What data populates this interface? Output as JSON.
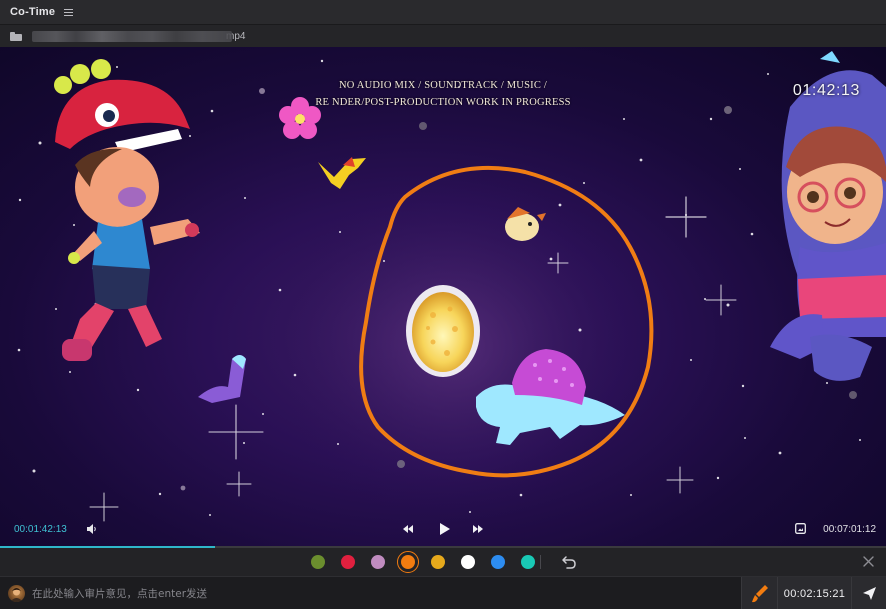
{
  "app": {
    "title": "Co-Time"
  },
  "file": {
    "name_visible_suffix": "mp4"
  },
  "video": {
    "watermark_line1": "NO AUDIO MIX / SOUNDTRACK / MUSIC /",
    "watermark_line2": "RE NDER/POST-PRODUCTION WORK IN PROGRESS",
    "timecode_overlay": "01:42:13"
  },
  "player": {
    "current_time": "00:01:42:13",
    "duration": "00:07:01:12",
    "progress_fraction": 0.243,
    "icons": [
      "volume-icon",
      "rewind-icon",
      "play-icon",
      "fast-forward-icon",
      "fullscreen-icon"
    ]
  },
  "annotation": {
    "colors": [
      "#6b8e2e",
      "#e0203f",
      "#c08cc0",
      "#f27c10",
      "#e6a91c",
      "#ffffff",
      "#2d8cf0",
      "#19c9b5"
    ],
    "selected_index": 3,
    "icons": [
      "undo-icon",
      "close-icon"
    ]
  },
  "comment": {
    "placeholder": "在此处输入审片意见，点击enter发送",
    "timestamp": "00:02:15:21",
    "icons": [
      "avatar",
      "brush-icon",
      "send-icon"
    ]
  }
}
